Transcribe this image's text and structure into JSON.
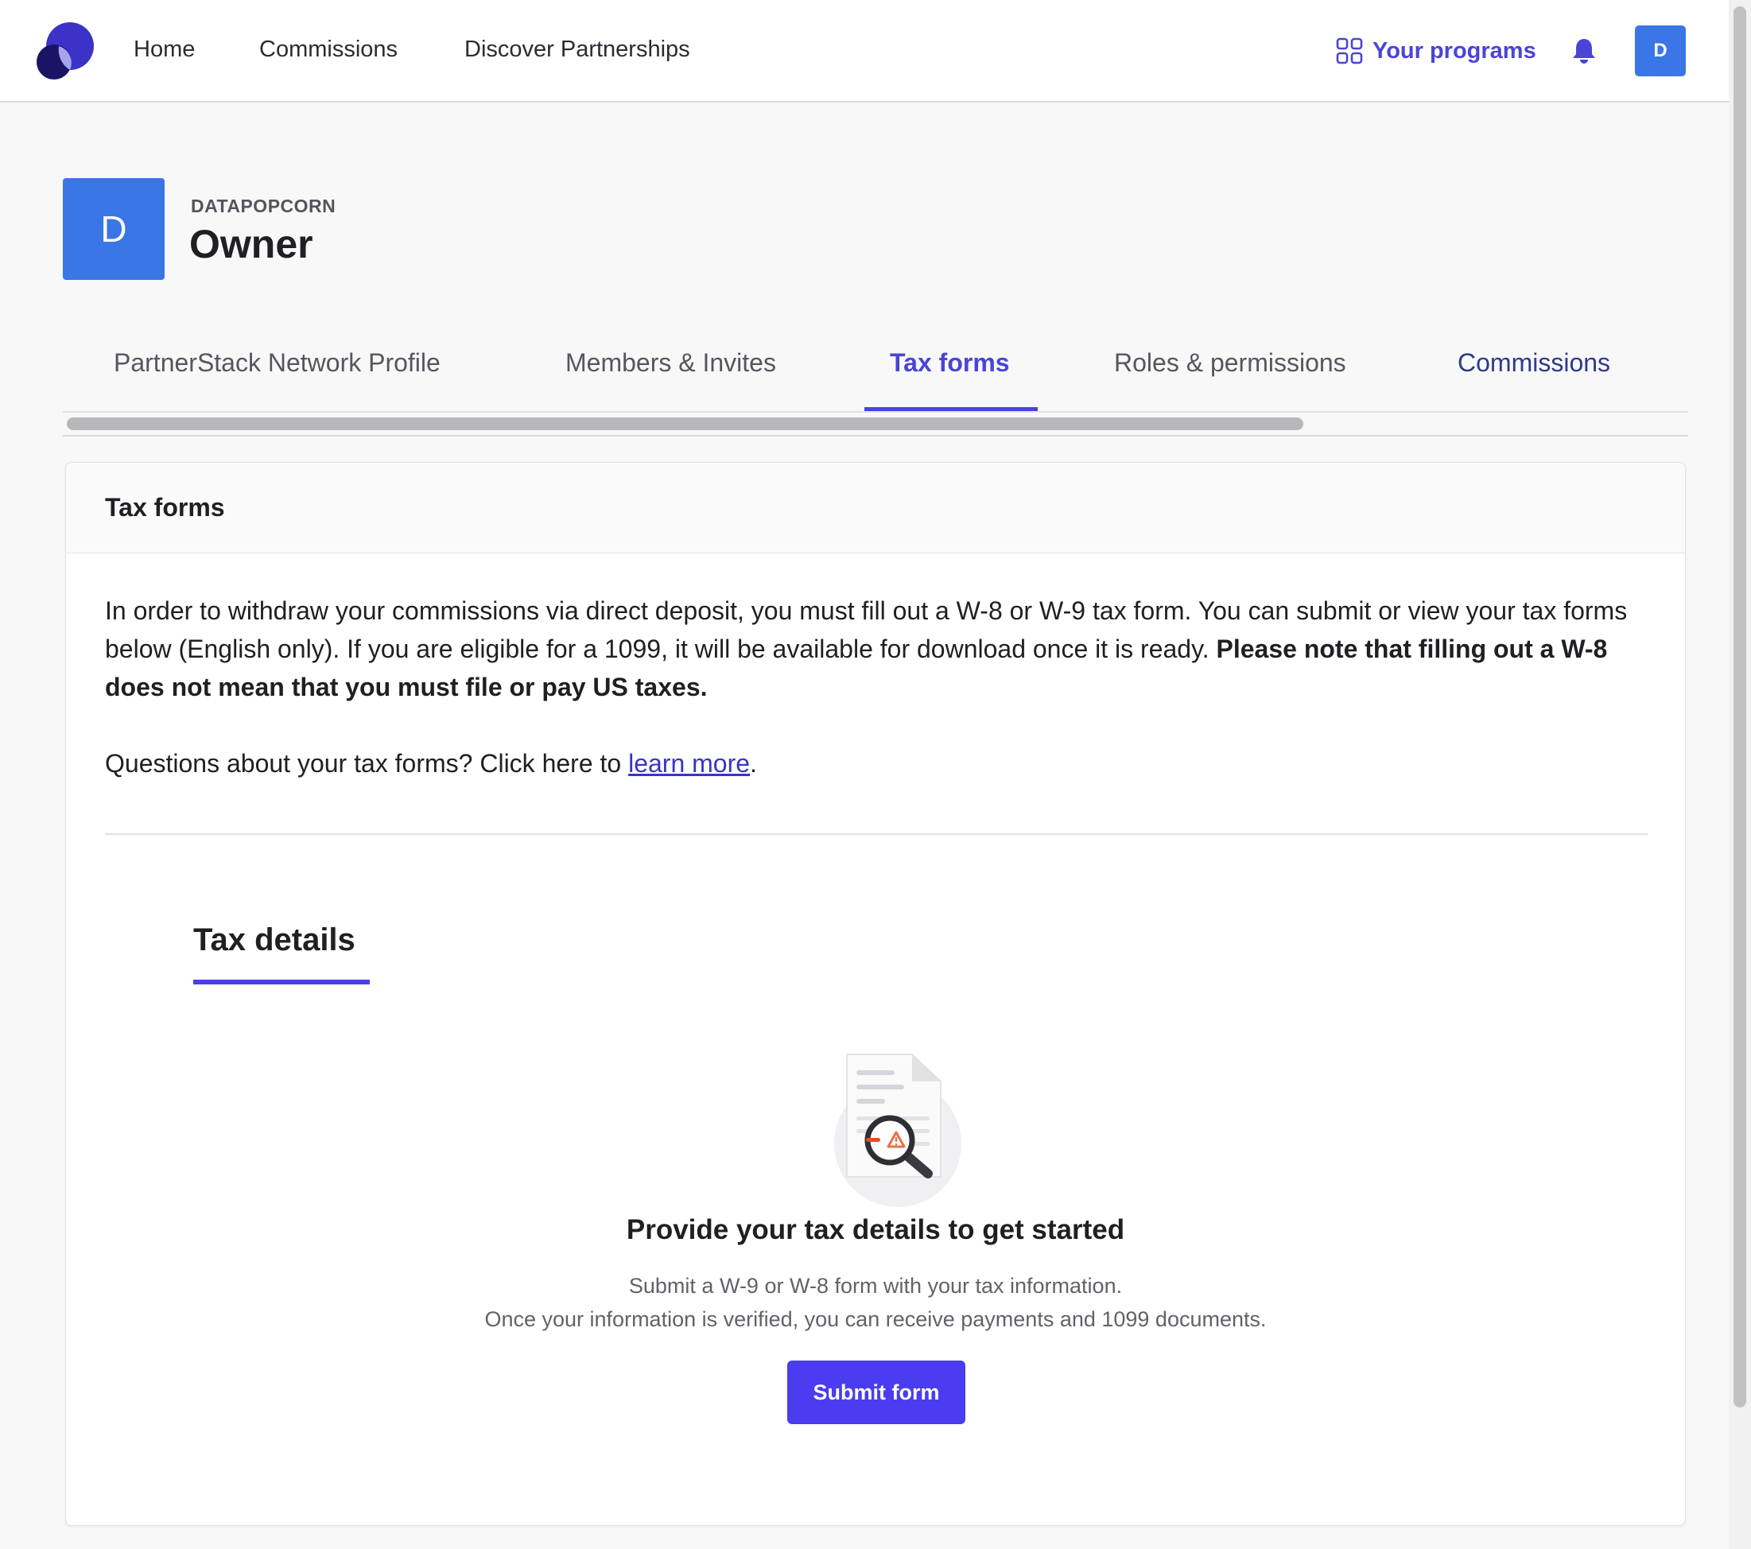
{
  "nav": {
    "links": [
      "Home",
      "Commissions",
      "Discover Partnerships"
    ],
    "your_programs": "Your programs",
    "avatar_initial": "D"
  },
  "header": {
    "avatar_initial": "D",
    "org_name": "DATAPOPCORN",
    "role": "Owner"
  },
  "tabs": [
    {
      "label": "PartnerStack Network Profile",
      "active": false
    },
    {
      "label": "Members & Invites",
      "active": false
    },
    {
      "label": "Tax forms",
      "active": true
    },
    {
      "label": "Roles & permissions",
      "active": false
    },
    {
      "label": "Commissions",
      "active": false
    }
  ],
  "card": {
    "title": "Tax forms",
    "intro_text": "In order to withdraw your commissions via direct deposit, you must fill out a W-8 or W-9 tax form. You can submit or view your tax forms below (English only). If you are eligible for a 1099, it will be available for download once it is ready. ",
    "intro_bold": "Please note that filling out a W-8 does not mean that you must file or pay US taxes.",
    "questions_prefix": "Questions about your tax forms? Click here to ",
    "learn_more": "learn more",
    "questions_suffix": "."
  },
  "tax_details": {
    "tab_label": "Tax details",
    "empty_title": "Provide your tax details to get started",
    "empty_line1": "Submit a W-9 or W-8 form with your tax information.",
    "empty_line2": "Once your information is verified, you can receive payments and 1099 documents.",
    "submit_label": "Submit form"
  },
  "colors": {
    "accent": "#4a44d6",
    "button": "#4a3cf0",
    "avatar": "#3a76e6"
  },
  "icons": [
    "partnerstack-logo",
    "grid-icon",
    "bell-icon",
    "document-search-icon"
  ]
}
